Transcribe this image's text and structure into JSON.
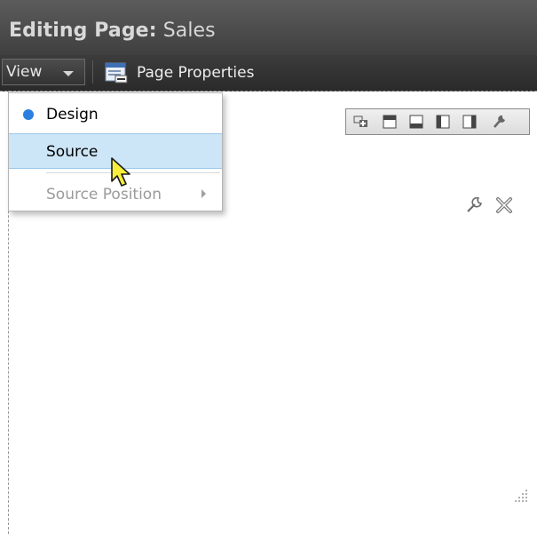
{
  "header": {
    "title_bold": "Editing Page:",
    "title_name": "Sales"
  },
  "toolbar": {
    "view_label": "View",
    "page_properties_label": "Page Properties"
  },
  "menu": {
    "items": [
      {
        "label": "Design",
        "selected": true
      },
      {
        "label": "Source",
        "hovered": true
      },
      {
        "label": "Source Position",
        "disabled": true,
        "has_submenu": true
      }
    ]
  },
  "icons": {
    "page_properties": "page-properties-icon",
    "region_toolbar": [
      "add-content-icon",
      "layout-top-icon",
      "layout-bottom-icon",
      "layout-left-icon",
      "layout-right-icon",
      "wrench-icon"
    ],
    "region_actions": [
      "edit-wrench-icon",
      "close-icon"
    ],
    "resize": "resize-grip-icon"
  },
  "colors": {
    "header_bg": "#4a4a4a",
    "toolbar_bg": "#333333",
    "menu_highlight": "#cce5f7",
    "radio_accent": "#2a7fe0"
  }
}
